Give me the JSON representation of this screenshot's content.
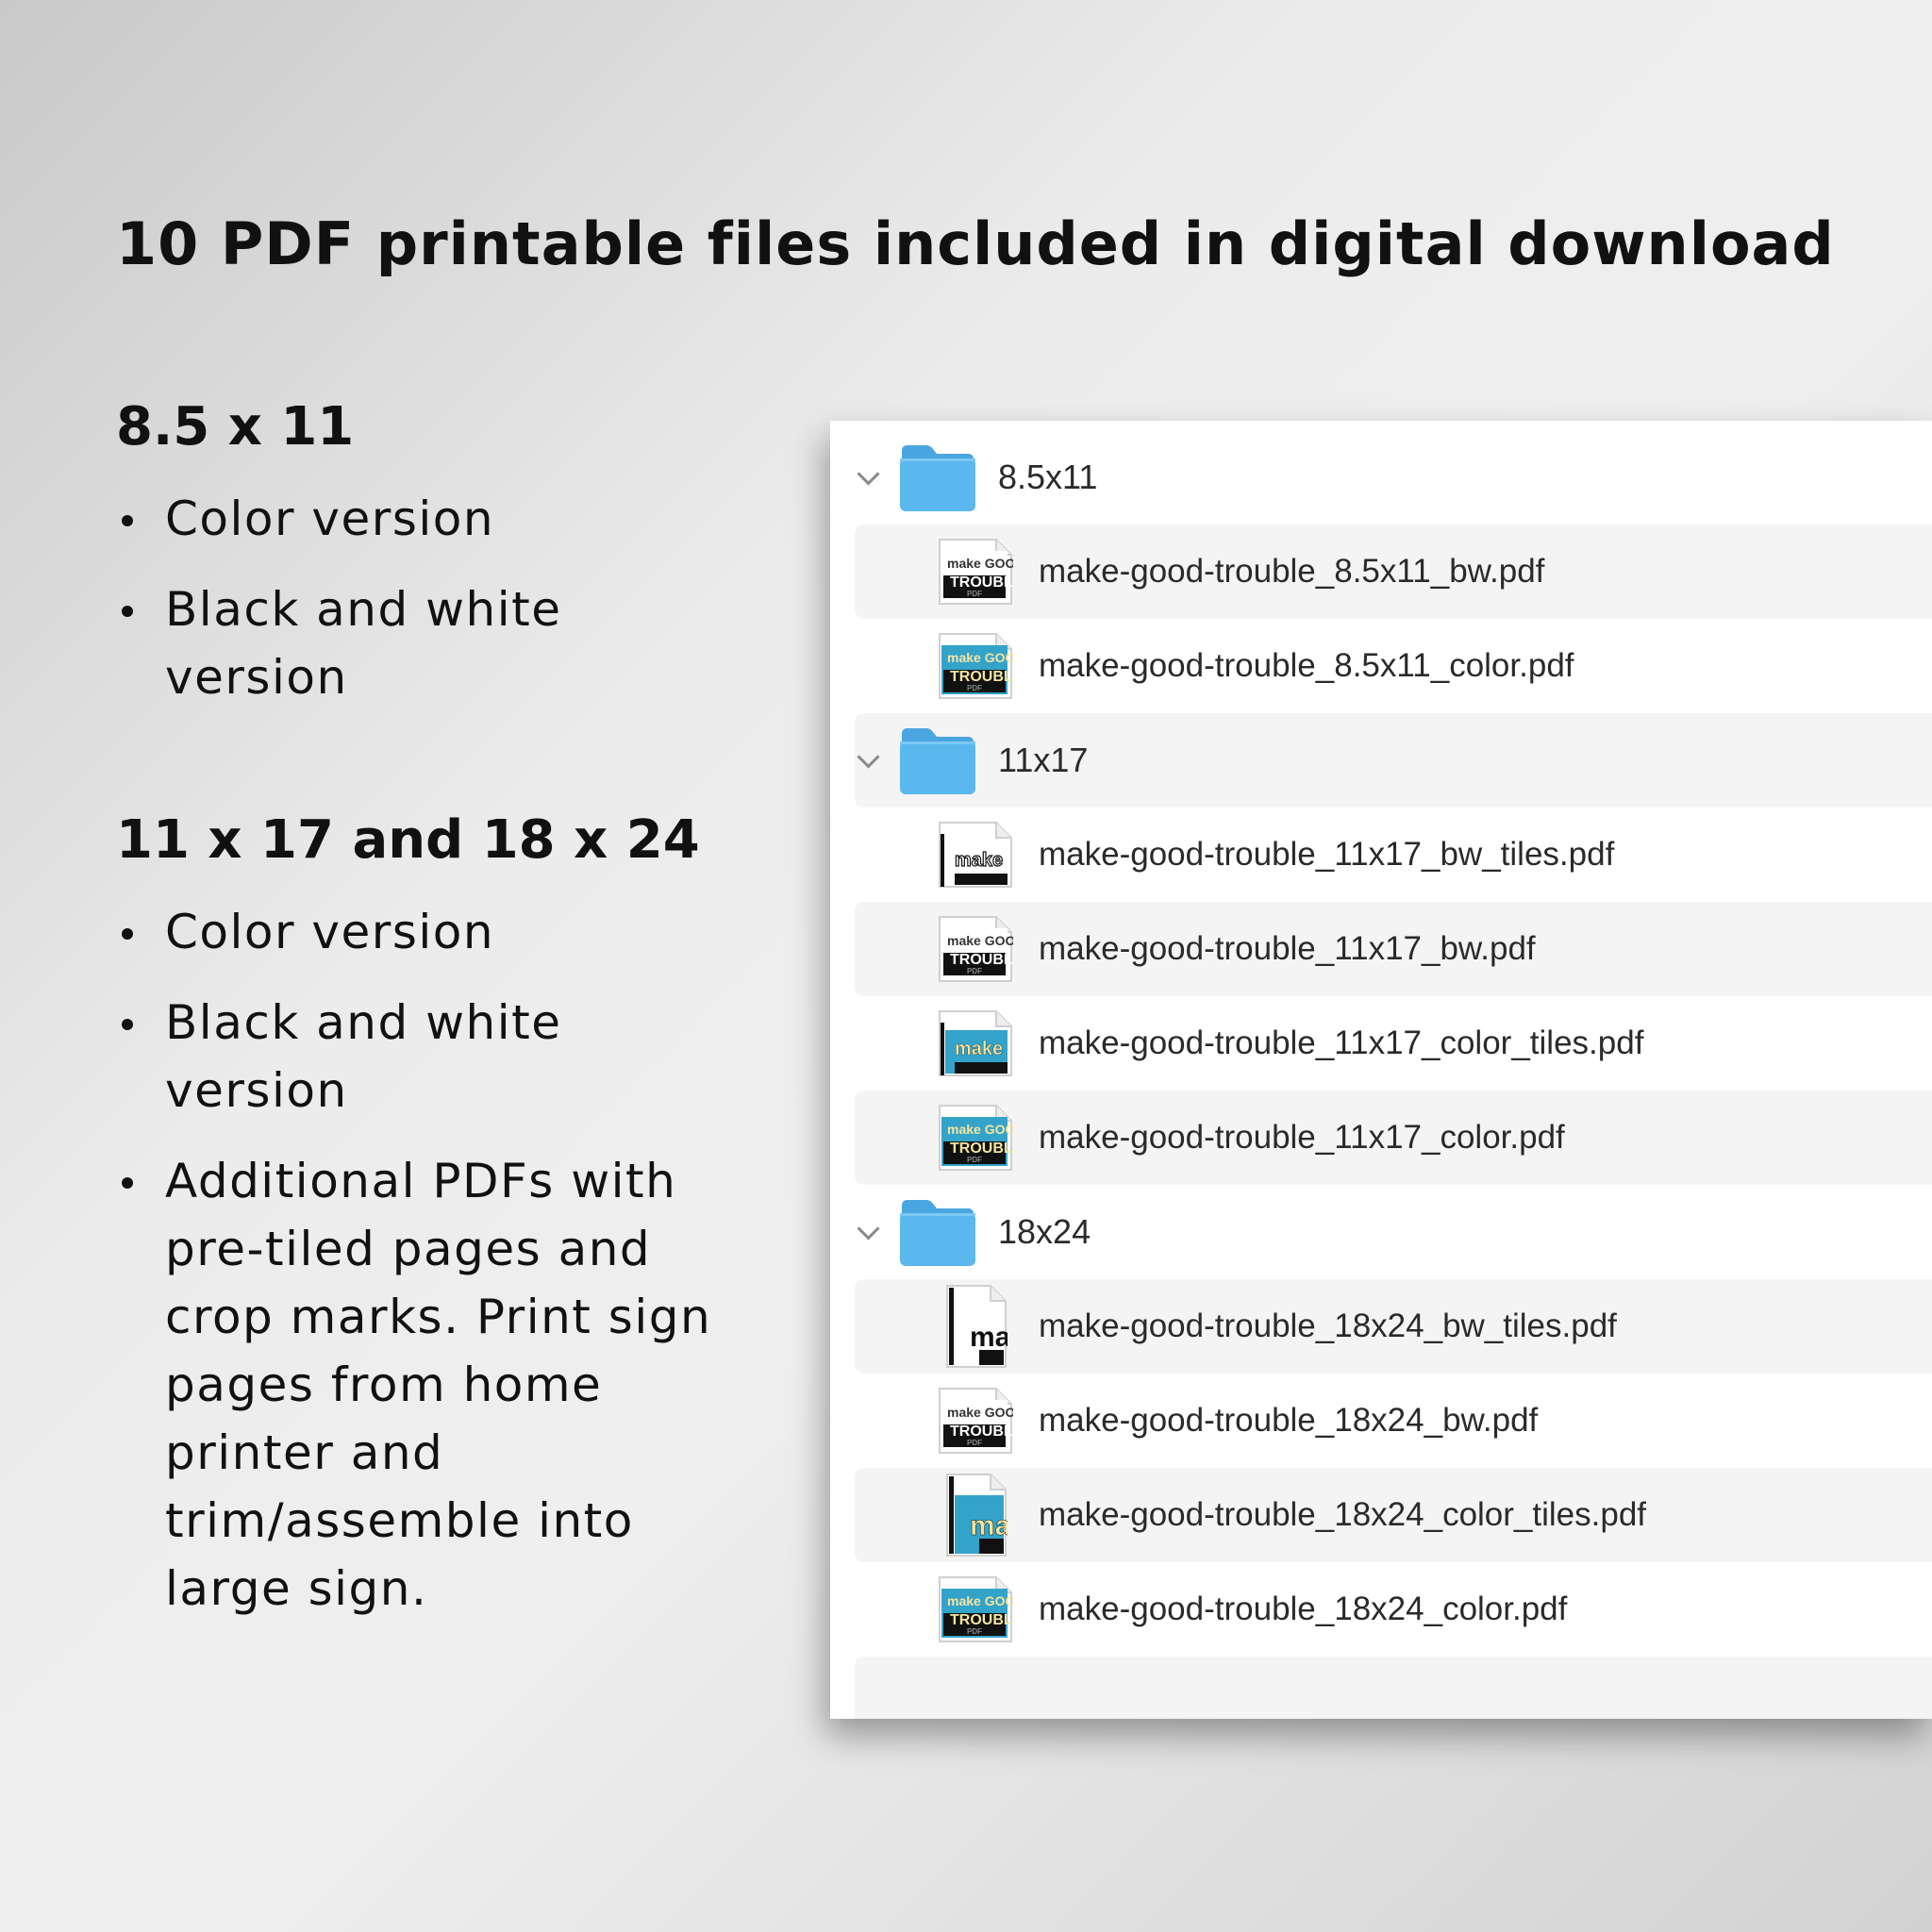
{
  "headline": "10 PDF printable files included in digital download",
  "sections": [
    {
      "title": "8.5 x 11",
      "bullets": [
        "Color version",
        "Black and white version"
      ]
    },
    {
      "title": "11 x 17 and 18 x 24",
      "bullets": [
        "Color version",
        "Black and white version",
        "Additional PDFs with pre-tiled pages and crop marks. Print sign pages from home printer and trim/assemble into large sign."
      ]
    }
  ],
  "finder": {
    "folders": [
      {
        "name": "8.5x11",
        "files": [
          {
            "name": "make-good-trouble_8.5x11_bw.pdf",
            "thumb": "bw"
          },
          {
            "name": "make-good-trouble_8.5x11_color.pdf",
            "thumb": "color"
          }
        ]
      },
      {
        "name": "11x17",
        "files": [
          {
            "name": "make-good-trouble_11x17_bw_tiles.pdf",
            "thumb": "bw-tiles"
          },
          {
            "name": "make-good-trouble_11x17_bw.pdf",
            "thumb": "bw"
          },
          {
            "name": "make-good-trouble_11x17_color_tiles.pdf",
            "thumb": "color-tiles"
          },
          {
            "name": "make-good-trouble_11x17_color.pdf",
            "thumb": "color"
          }
        ]
      },
      {
        "name": "18x24",
        "files": [
          {
            "name": "make-good-trouble_18x24_bw_tiles.pdf",
            "thumb": "bw-tall"
          },
          {
            "name": "make-good-trouble_18x24_bw.pdf",
            "thumb": "bw"
          },
          {
            "name": "make-good-trouble_18x24_color_tiles.pdf",
            "thumb": "color-tall"
          },
          {
            "name": "make-good-trouble_18x24_color.pdf",
            "thumb": "color"
          }
        ]
      }
    ]
  },
  "colors": {
    "folder": "#5ab8ee",
    "folder_tab": "#4aa6e0",
    "thumb_color_bg": "#33a3c9",
    "thumb_text_yellow": "#f4e4a0"
  }
}
